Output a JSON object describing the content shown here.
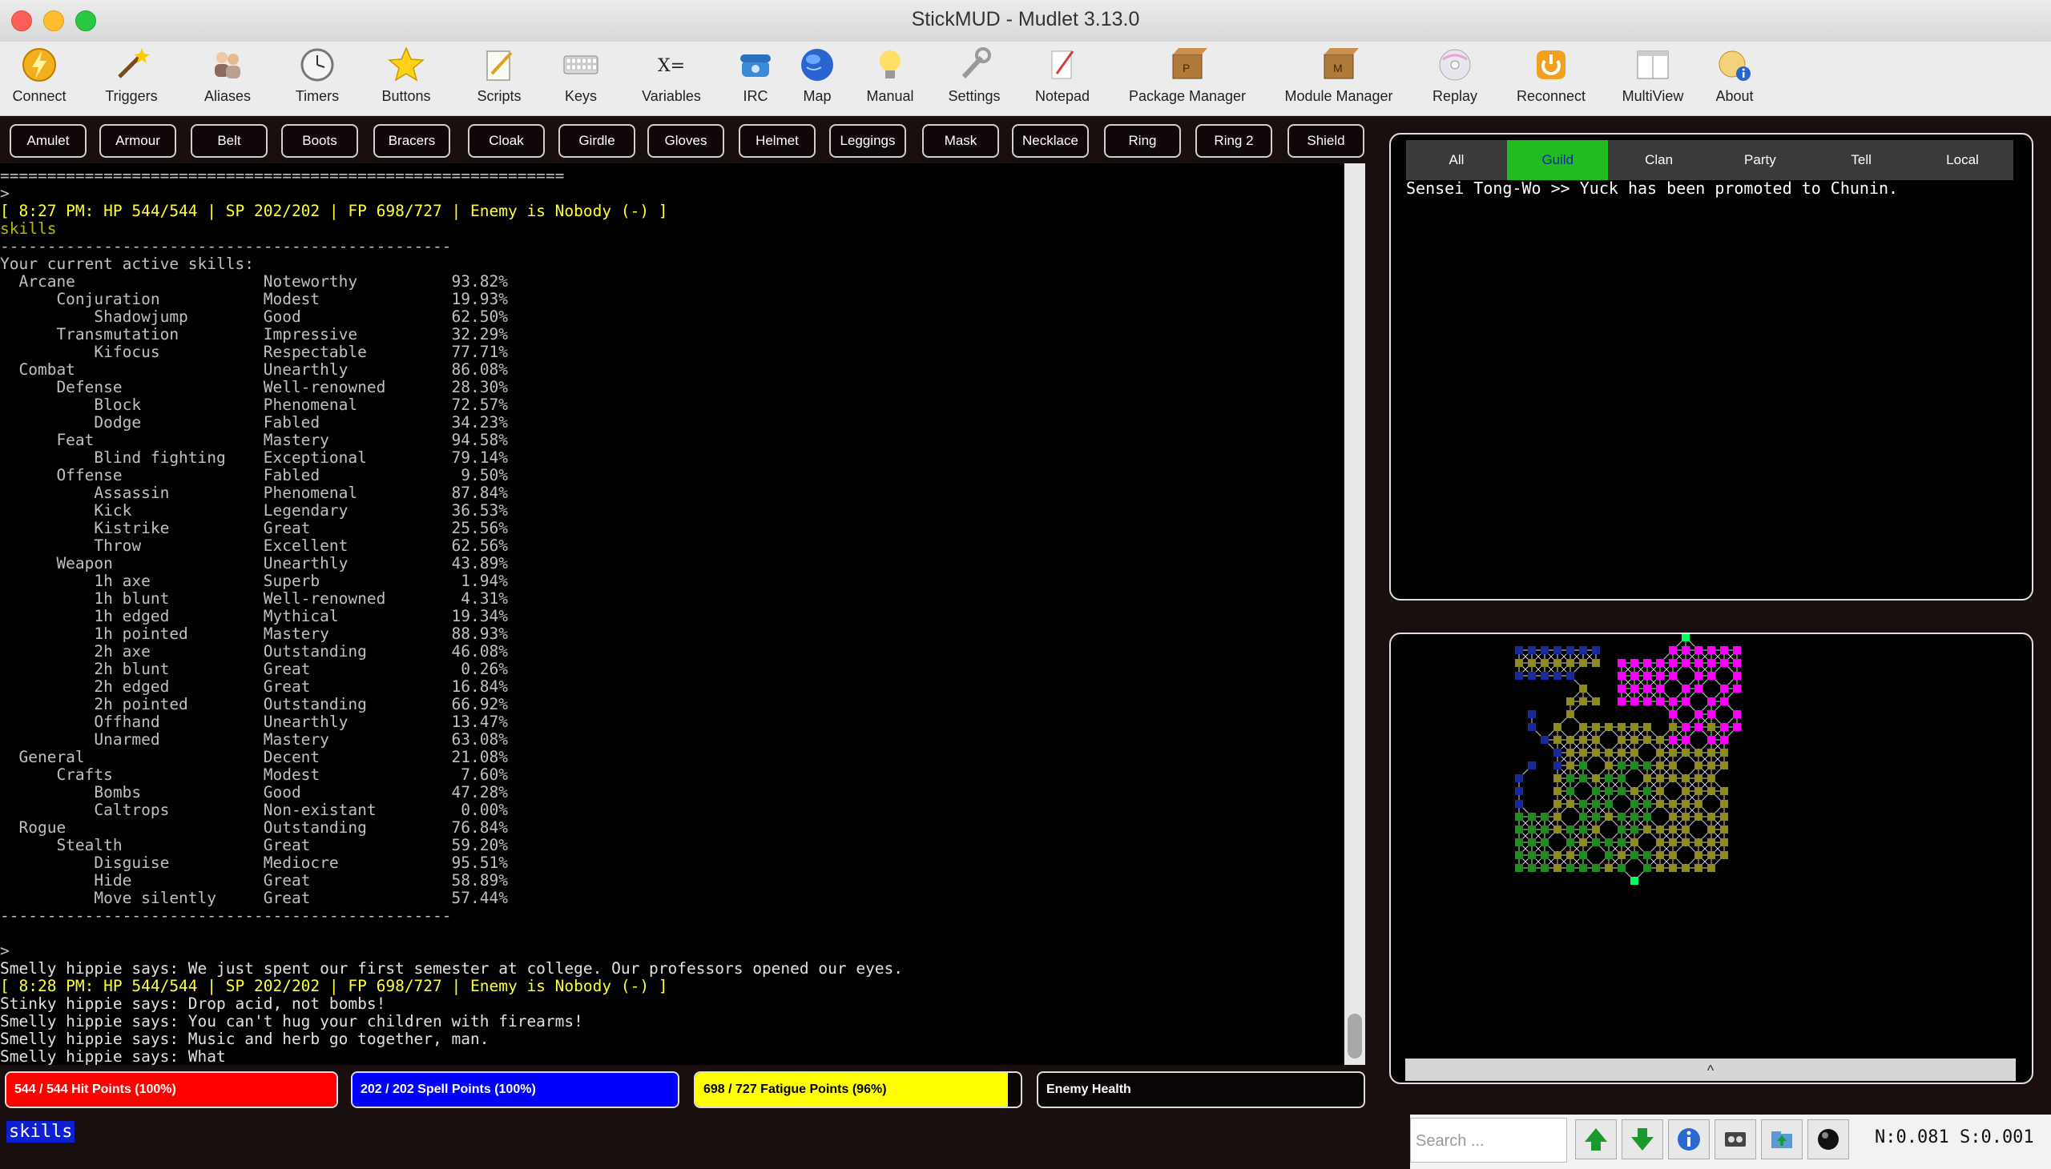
{
  "window": {
    "title": "StickMUD - Mudlet 3.13.0"
  },
  "toolbar": [
    {
      "label": "Connect",
      "icon": "lightning-icon"
    },
    {
      "label": "Triggers",
      "icon": "wand-icon"
    },
    {
      "label": "Aliases",
      "icon": "people-icon"
    },
    {
      "label": "Timers",
      "icon": "clock-icon"
    },
    {
      "label": "Buttons",
      "icon": "star-icon"
    },
    {
      "label": "Scripts",
      "icon": "scroll-icon"
    },
    {
      "label": "Keys",
      "icon": "keyboard-icon"
    },
    {
      "label": "Variables",
      "icon": "variable-icon"
    },
    {
      "label": "IRC",
      "icon": "phone-icon"
    },
    {
      "label": "Map",
      "icon": "globe-icon"
    },
    {
      "label": "Manual",
      "icon": "bulb-icon"
    },
    {
      "label": "Settings",
      "icon": "wrench-icon"
    },
    {
      "label": "Notepad",
      "icon": "notepad-icon"
    },
    {
      "label": "Package Manager",
      "icon": "package-icon"
    },
    {
      "label": "Module Manager",
      "icon": "module-icon"
    },
    {
      "label": "Replay",
      "icon": "disc-icon"
    },
    {
      "label": "Reconnect",
      "icon": "reconnect-icon"
    },
    {
      "label": "MultiView",
      "icon": "multiview-icon"
    },
    {
      "label": "About",
      "icon": "about-icon"
    }
  ],
  "equipment": [
    "Amulet",
    "Armour",
    "Belt",
    "Boots",
    "Bracers",
    "Cloak",
    "Girdle",
    "Gloves",
    "Helmet",
    "Leggings",
    "Mask",
    "Necklace",
    "Ring",
    "Ring 2",
    "Shield"
  ],
  "console_lines": [
    {
      "text": "============================================================",
      "color": "#c0c0c0"
    },
    {
      "text": ">",
      "color": "#c0c0c0"
    },
    {
      "text": "[ 8:27 PM: HP 544/544 | SP 202/202 | FP 698/727 | Enemy is Nobody (-) ]",
      "color": "#ffff33"
    },
    {
      "text": "skills",
      "color": "#b8b800"
    },
    {
      "text": "------------------------------------------------",
      "color": "#c0c0c0"
    },
    {
      "text": "Your current active skills:",
      "color": "#c0c0c0"
    },
    {
      "text": "  Arcane                    Noteworthy          93.82%",
      "color": "#c0c0c0"
    },
    {
      "text": "      Conjuration           Modest              19.93%",
      "color": "#c0c0c0"
    },
    {
      "text": "          Shadowjump        Good                62.50%",
      "color": "#c0c0c0"
    },
    {
      "text": "      Transmutation         Impressive          32.29%",
      "color": "#c0c0c0"
    },
    {
      "text": "          Kifocus           Respectable         77.71%",
      "color": "#c0c0c0"
    },
    {
      "text": "  Combat                    Unearthly           86.08%",
      "color": "#c0c0c0"
    },
    {
      "text": "      Defense               Well-renowned       28.30%",
      "color": "#c0c0c0"
    },
    {
      "text": "          Block             Phenomenal          72.57%",
      "color": "#c0c0c0"
    },
    {
      "text": "          Dodge             Fabled              34.23%",
      "color": "#c0c0c0"
    },
    {
      "text": "      Feat                  Mastery             94.58%",
      "color": "#c0c0c0"
    },
    {
      "text": "          Blind fighting    Exceptional         79.14%",
      "color": "#c0c0c0"
    },
    {
      "text": "      Offense               Fabled               9.50%",
      "color": "#c0c0c0"
    },
    {
      "text": "          Assassin          Phenomenal          87.84%",
      "color": "#c0c0c0"
    },
    {
      "text": "          Kick              Legendary           36.53%",
      "color": "#c0c0c0"
    },
    {
      "text": "          Kistrike          Great               25.56%",
      "color": "#c0c0c0"
    },
    {
      "text": "          Throw             Excellent           62.56%",
      "color": "#c0c0c0"
    },
    {
      "text": "      Weapon                Unearthly           43.89%",
      "color": "#c0c0c0"
    },
    {
      "text": "          1h axe            Superb               1.94%",
      "color": "#c0c0c0"
    },
    {
      "text": "          1h blunt          Well-renowned        4.31%",
      "color": "#c0c0c0"
    },
    {
      "text": "          1h edged          Mythical            19.34%",
      "color": "#c0c0c0"
    },
    {
      "text": "          1h pointed        Mastery             88.93%",
      "color": "#c0c0c0"
    },
    {
      "text": "          2h axe            Outstanding         46.08%",
      "color": "#c0c0c0"
    },
    {
      "text": "          2h blunt          Great                0.26%",
      "color": "#c0c0c0"
    },
    {
      "text": "          2h edged          Great               16.84%",
      "color": "#c0c0c0"
    },
    {
      "text": "          2h pointed        Outstanding         66.92%",
      "color": "#c0c0c0"
    },
    {
      "text": "          Offhand           Unearthly           13.47%",
      "color": "#c0c0c0"
    },
    {
      "text": "          Unarmed           Mastery             63.08%",
      "color": "#c0c0c0"
    },
    {
      "text": "  General                   Decent              21.08%",
      "color": "#c0c0c0"
    },
    {
      "text": "      Crafts                Modest               7.60%",
      "color": "#c0c0c0"
    },
    {
      "text": "          Bombs             Good                47.28%",
      "color": "#c0c0c0"
    },
    {
      "text": "          Caltrops          Non-existant         0.00%",
      "color": "#c0c0c0"
    },
    {
      "text": "  Rogue                     Outstanding         76.84%",
      "color": "#c0c0c0"
    },
    {
      "text": "      Stealth               Great               59.20%",
      "color": "#c0c0c0"
    },
    {
      "text": "          Disguise          Mediocre            95.51%",
      "color": "#c0c0c0"
    },
    {
      "text": "          Hide              Great               58.89%",
      "color": "#c0c0c0"
    },
    {
      "text": "          Move silently     Great               57.44%",
      "color": "#c0c0c0"
    },
    {
      "text": "------------------------------------------------",
      "color": "#c0c0c0"
    },
    {
      "text": "",
      "color": "#c0c0c0"
    },
    {
      "text": ">",
      "color": "#c0c0c0"
    },
    {
      "text": "Smelly hippie says: We just spent our first semester at college. Our professors opened our eyes.",
      "color": "#e0e0e0"
    },
    {
      "text": "[ 8:28 PM: HP 544/544 | SP 202/202 | FP 698/727 | Enemy is Nobody (-) ]",
      "color": "#ffff33"
    },
    {
      "text": "Stinky hippie says: Drop acid, not bombs!",
      "color": "#e0e0e0"
    },
    {
      "text": "Smelly hippie says: You can't hug your children with firearms!",
      "color": "#e0e0e0"
    },
    {
      "text": "Smelly hippie says: Music and herb go together, man.",
      "color": "#e0e0e0"
    },
    {
      "text": "Smelly hippie says: What",
      "color": "#e0e0e0"
    }
  ],
  "gauges": {
    "hp": {
      "label": "544 / 544 Hit Points (100%)",
      "fraction": 1.0,
      "color": "#ff0000",
      "text_color": "#ffffff"
    },
    "sp": {
      "label": "202 / 202 Spell Points (100%)",
      "fraction": 1.0,
      "color": "#0000ff",
      "text_color": "#ffffff"
    },
    "fp": {
      "label": "698 / 727 Fatigue Points (96%)",
      "fraction": 0.96,
      "color": "#ffff00",
      "text_color": "#000000"
    },
    "enemy": {
      "label": "Enemy Health",
      "fraction": 0.0,
      "color": "#880000",
      "text_color": "#ffffff"
    }
  },
  "command_input": "skills",
  "chat": {
    "tabs": [
      "All",
      "Guild",
      "Clan",
      "Party",
      "Tell",
      "Local"
    ],
    "active_tab": "Guild",
    "active_color": "#22bb22",
    "lines": [
      "Sensei Tong-Wo >> Yuck has been promoted to Chunin."
    ]
  },
  "map": {
    "colors": {
      "blue": "#1a2a9a",
      "olive": "#8c8c20",
      "green": "#1e8c1e",
      "magenta": "#ff00ff",
      "current": "#00ff66"
    },
    "collapse_glyph": "^"
  },
  "bottom": {
    "search_placeholder": "Search ...",
    "icons": [
      "up-arrow-icon",
      "down-arrow-icon",
      "info-icon",
      "tape-icon",
      "folder-icon",
      "ball-icon"
    ],
    "net_stat": "N:0.081 S:0.001"
  }
}
